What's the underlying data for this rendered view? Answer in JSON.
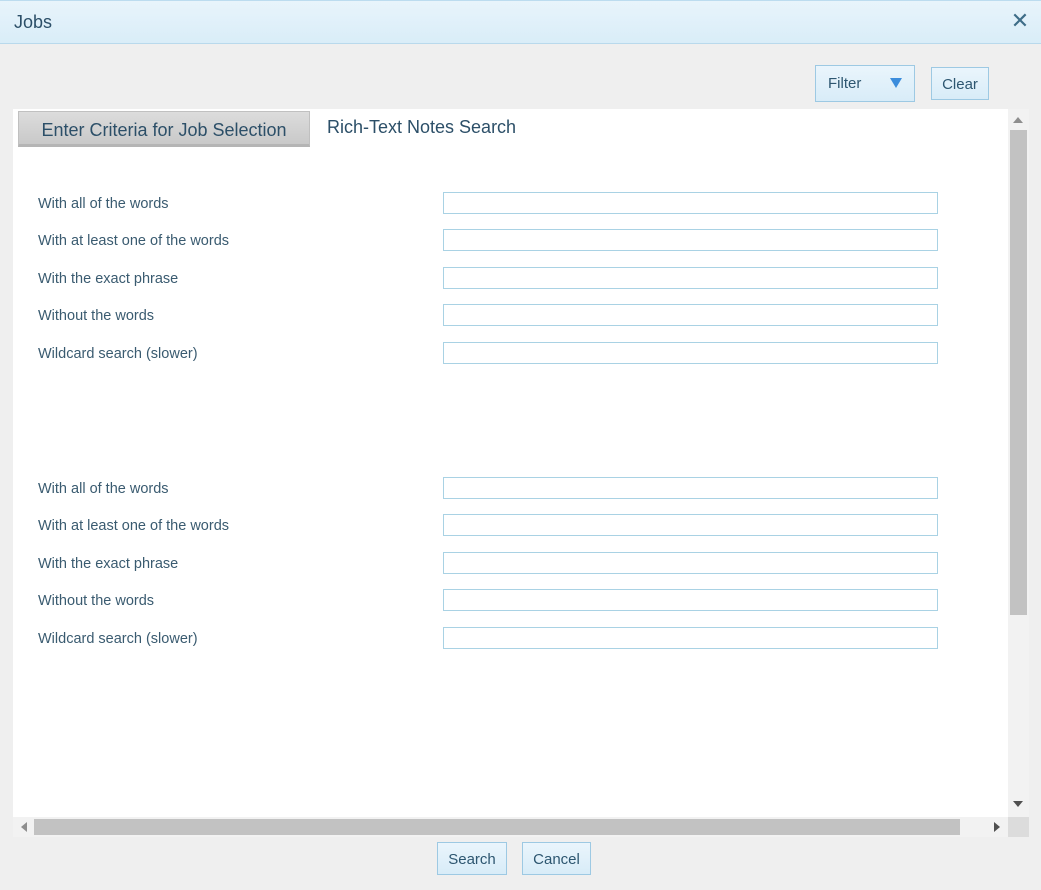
{
  "window": {
    "title": "Jobs"
  },
  "toolbar": {
    "filter_label": "Filter",
    "clear_label": "Clear"
  },
  "tabs": [
    {
      "label": "Enter Criteria for Job Selection",
      "active": true
    },
    {
      "label": "Rich-Text Notes Search",
      "active": false
    }
  ],
  "section1": {
    "fields": [
      {
        "label": "With all of the words",
        "value": ""
      },
      {
        "label": "With at least one of the words",
        "value": ""
      },
      {
        "label": "With the exact phrase",
        "value": ""
      },
      {
        "label": "Without the words",
        "value": ""
      },
      {
        "label": "Wildcard search (slower)",
        "value": ""
      }
    ]
  },
  "section2": {
    "fields": [
      {
        "label": "With all of the words",
        "value": ""
      },
      {
        "label": "With at least one of the words",
        "value": ""
      },
      {
        "label": "With the exact phrase",
        "value": ""
      },
      {
        "label": "Without the words",
        "value": ""
      },
      {
        "label": "Wildcard search (slower)",
        "value": ""
      }
    ]
  },
  "footer": {
    "search_label": "Search",
    "cancel_label": "Cancel"
  },
  "colors": {
    "accent": "#3c8ddc",
    "titlebar": "#d9edf8",
    "field_border": "#a9d2e4"
  }
}
